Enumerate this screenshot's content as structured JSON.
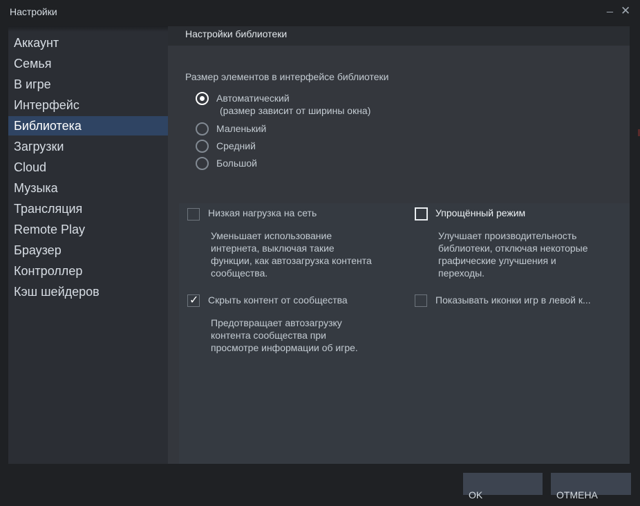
{
  "window": {
    "title": "Настройки",
    "minimize": "_",
    "close": "✕"
  },
  "sidebar": {
    "items": [
      {
        "label": "Аккаунт"
      },
      {
        "label": "Семья"
      },
      {
        "label": "В игре"
      },
      {
        "label": "Интерфейс"
      },
      {
        "label": "Библиотека",
        "active": true
      },
      {
        "label": "Загрузки"
      },
      {
        "label": "Cloud"
      },
      {
        "label": "Музыка"
      },
      {
        "label": "Трансляция"
      },
      {
        "label": "Remote Play"
      },
      {
        "label": "Браузер"
      },
      {
        "label": "Контроллер"
      },
      {
        "label": "Кэш шейдеров"
      }
    ]
  },
  "main": {
    "title": "Настройки библиотеки",
    "size_section": {
      "title": "Размер элементов в интерфейсе библиотеки",
      "options": [
        {
          "label": "Автоматический",
          "checked": true
        },
        {
          "label": "Маленький",
          "checked": false
        },
        {
          "label": "Средний",
          "checked": false
        },
        {
          "label": "Большой",
          "checked": false
        }
      ],
      "auto_note": "(размер зависит от ширины окна)"
    },
    "options": {
      "low_bandwidth": {
        "label": "Низкая нагрузка на сеть",
        "checked": false,
        "desc": [
          "Уменьшает использование",
          "интернета, выключая такие",
          "функции, как автозагрузка контента",
          "сообщества."
        ]
      },
      "low_perf": {
        "label": "Упрощённый режим",
        "checked": false,
        "desc": [
          "Улучшает производительность",
          "библиотеки, отключая некоторые",
          "графические улучшения и",
          "переходы."
        ]
      },
      "hide_community": {
        "label": "Скрыть контент от сообщества",
        "checked": true,
        "desc": [
          "Предотвращает автозагрузку",
          "контента сообщества при",
          "просмотре информации об игре."
        ]
      },
      "show_icons": {
        "label": "Показывать иконки игр в левой к...",
        "checked": false
      }
    }
  },
  "footer": {
    "ok": "OK",
    "cancel": "ОТМЕНА"
  },
  "colors": {
    "active": "#2f4463",
    "bg": "#1f2124",
    "panel": "#34373d",
    "sidebar": "#2b2e34"
  },
  "icons": {
    "minimize": "minimize-icon",
    "close": "close-icon",
    "check": "checkmark-icon"
  }
}
